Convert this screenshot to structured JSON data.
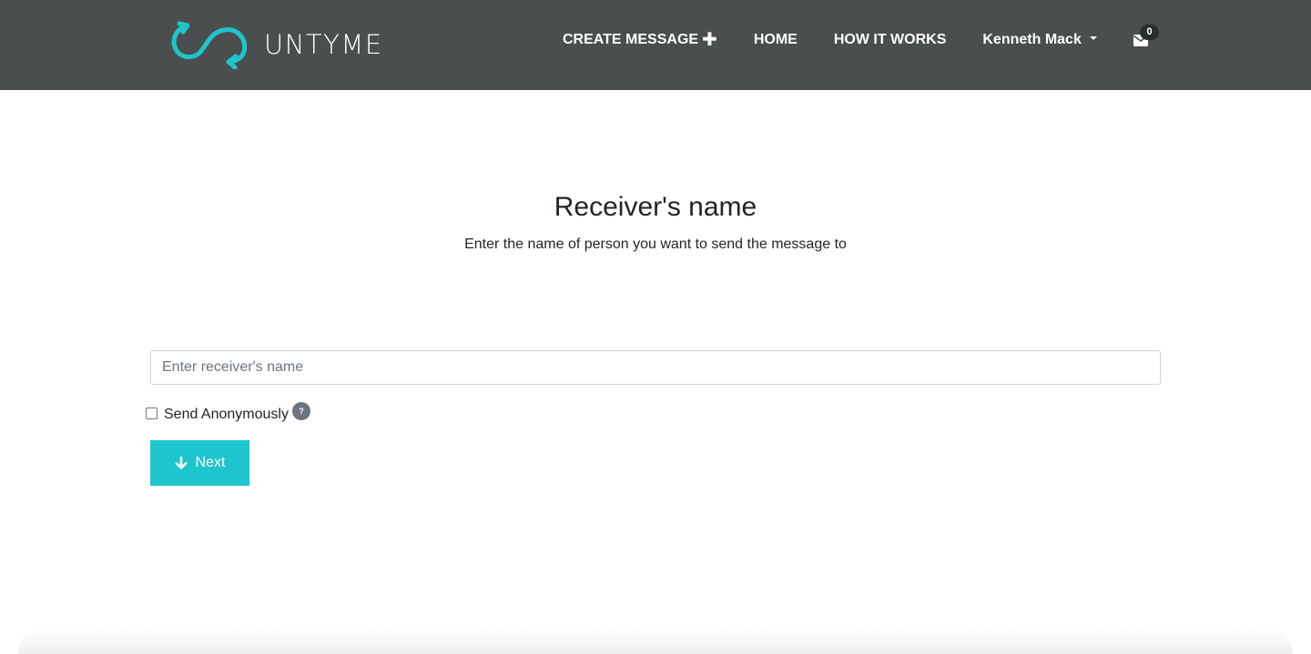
{
  "brand": {
    "name": "UNTYME",
    "accent_color": "#1ec5cc",
    "logo_icon": "loop-arrows-icon"
  },
  "nav": {
    "create_message": "CREATE MESSAGE",
    "create_icon": "plus-icon",
    "home": "HOME",
    "how_it_works": "HOW IT WORKS",
    "user_name": "Kenneth Mack",
    "user_icon": "caret-down-icon",
    "mail_icon": "envelope-icon",
    "mail_count": "0"
  },
  "main": {
    "title": "Receiver's name",
    "subtitle": "Enter the name of person you want to send the message to",
    "receiver_input": {
      "value": "",
      "placeholder": "Enter receiver's name"
    },
    "anonymous": {
      "label": "Send Anonymously",
      "checked": false,
      "help_icon": "question-icon"
    },
    "next_button": {
      "label": "Next",
      "icon": "arrow-down-icon"
    }
  }
}
